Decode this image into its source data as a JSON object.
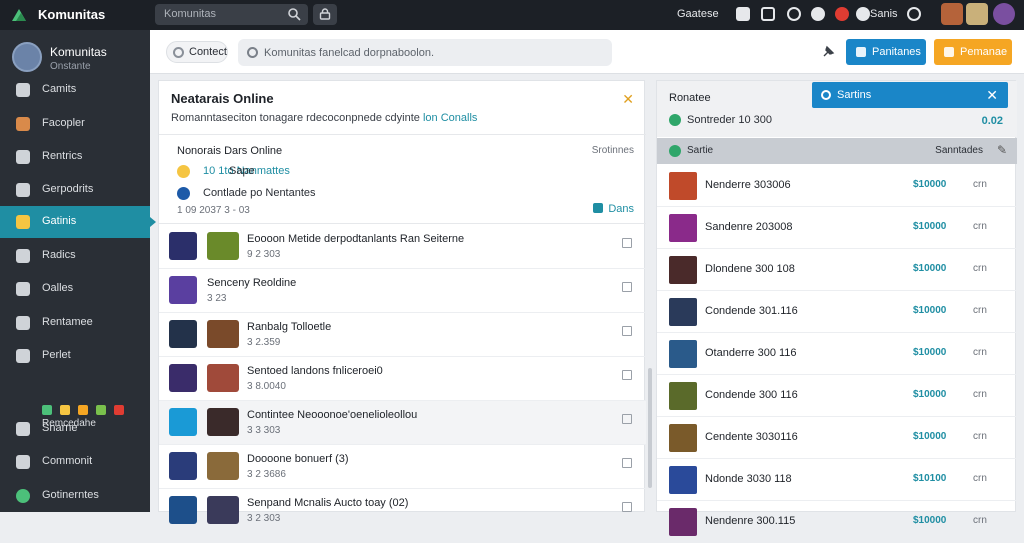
{
  "topbar": {
    "brand": "Komunitas",
    "search_placeholder": "Komunitas",
    "label": "Gaatese",
    "user_name": "Sanis"
  },
  "sidebar": {
    "user_name": "Komunitas",
    "user_status": "Onstante",
    "items": [
      {
        "label": "Camits",
        "icon": "chart-icon"
      },
      {
        "label": "Facopler",
        "icon": "user-icon"
      },
      {
        "label": "Rentrics",
        "icon": "rocket-icon"
      },
      {
        "label": "Gerpodrits",
        "icon": "chat-icon"
      },
      {
        "label": "Gatinis",
        "icon": "folder-icon",
        "active": true
      },
      {
        "label": "Radics",
        "icon": "message-icon"
      },
      {
        "label": "Oalles",
        "icon": "search-icon"
      },
      {
        "label": "Rentamee",
        "icon": "gear-icon"
      },
      {
        "label": "Perlet",
        "icon": "chart-bar-icon"
      },
      {
        "label": "Snarne",
        "icon": "rocket-icon"
      },
      {
        "label": "Commonit",
        "icon": "globe-icon"
      },
      {
        "label": "Gotinerntes",
        "icon": "toggle-icon"
      }
    ],
    "emoji_label": "Remcedahe"
  },
  "toolbar": {
    "contact": "Contect",
    "search_placeholder": "Komunitas fanelcad dorpnaboolon.",
    "button_primary": "Panitanes",
    "button_secondary": "Pemanae",
    "colors": {
      "primary": "#1a86c8",
      "secondary": "#f5a623"
    }
  },
  "panel": {
    "title": "Neatarais Online",
    "subtitle_prefix": "Romanntaseciton tonagare rdecoconpnede cdyinte",
    "subtitle_link": "lon Conalls",
    "card": {
      "title": "Nonorais Dars Online",
      "right_label": "Srotinnes",
      "line1_prefix": "Sape",
      "line1_link": "10 1to Nanmattes",
      "line2": "Contlade po Nentantes",
      "date": "1 09 2037 3 - 03",
      "button": "Dans"
    },
    "items": [
      {
        "name": "Eoooon Metide derpodtanlants Ran Seiterne",
        "meta": "9 2 303",
        "gray": false
      },
      {
        "name": "Senceny Reoldine",
        "meta": "3 23",
        "gray": false
      },
      {
        "name": "Ranbalg Tolloetle",
        "meta": "3 2.359",
        "gray": false
      },
      {
        "name": "Sentoed landons fnliceroei0",
        "meta": "3 8.0040",
        "gray": false
      },
      {
        "name": "Contintee Neooonoe'oenelioleollou",
        "meta": "3 3 303",
        "gray": true
      },
      {
        "name": "Doooone bonuerf (3)",
        "meta": "3 2 3686",
        "gray": false
      },
      {
        "name": "Senpand Mcnalis Aucto toay (02)",
        "meta": "3 2 303",
        "gray": false
      }
    ]
  },
  "right": {
    "title": "Ronatee",
    "status_label": "Sontreder 10 300",
    "value": "0.02",
    "toast": "Sartins",
    "column_left": "Sartie",
    "column_right": "Sanntades",
    "rows": [
      {
        "name": "Nenderre 303006",
        "price": "$10000",
        "unit": "crn"
      },
      {
        "name": "Sandenre 203008",
        "price": "$10000",
        "unit": "crn"
      },
      {
        "name": "Dlondene 300 108",
        "price": "$10000",
        "unit": "crn"
      },
      {
        "name": "Condende 301.116",
        "price": "$10000",
        "unit": "crn"
      },
      {
        "name": "Otanderre 300 116",
        "price": "$10000",
        "unit": "crn"
      },
      {
        "name": "Condende 300 116",
        "price": "$10000",
        "unit": "crn"
      },
      {
        "name": "Cendente 3030116",
        "price": "$10000",
        "unit": "crn"
      },
      {
        "name": "Ndonde 3030 118",
        "price": "$10100",
        "unit": "crn"
      },
      {
        "name": "Nendenre 300.115",
        "price": "$10000",
        "unit": "crn"
      }
    ]
  }
}
